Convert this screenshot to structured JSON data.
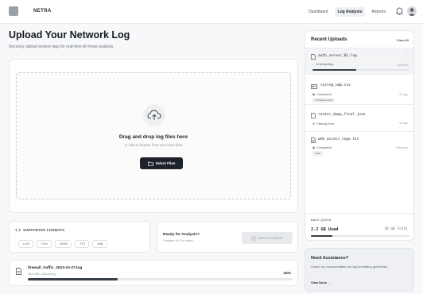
{
  "header": {
    "brand": "NETRA",
    "nav": [
      "Dashboard",
      "Log Analysis",
      "Reports"
    ],
    "active_nav": "Log Analysis"
  },
  "page": {
    "title": "Upload Your Network Log",
    "subtitle": "Securely upload system logs for real-time AI threat analysis."
  },
  "dropzone": {
    "title": "Drag and drop log files here",
    "subtitle": "or click to browse from your local drive",
    "button_label": "Select Files"
  },
  "formats": {
    "title": "SUPPORTED FORMATS",
    "items": [
      ".LOG",
      ".CSV",
      ".JSON",
      ".TXT",
      ".XML"
    ]
  },
  "ready": {
    "title": "Ready for Analysis?",
    "subtitle": "0 engine v3.0 is active.",
    "button_label": "Start AI Analysis"
  },
  "current_upload": {
    "file_name": "firewall_traffic_2023-10-27.log",
    "meta": "45.2 MB • Uploading...",
    "percent_label": "34%",
    "progress": 0.34
  },
  "recent": {
    "title": "Recent Uploads",
    "view_all": "View All",
    "items": [
      {
        "name": "auth_server_01.log",
        "status": "AI Analyzing...",
        "time": "Just Now",
        "tag": "",
        "progress": 0.45
      },
      {
        "name": "syslog_udp.csv",
        "status": "Completed",
        "time": "2h ago",
        "tag": "4 Threats Found",
        "progress": null
      },
      {
        "name": "router_dump_final.json",
        "status": "Parsing Error",
        "time": "5h ago",
        "tag": "",
        "progress": null
      },
      {
        "name": "web_access_logs.txt",
        "status": "Completed",
        "time": "Yesterday",
        "tag": "Clear",
        "progress": null
      }
    ]
  },
  "quota": {
    "label": "DAILY QUOTA",
    "used": "2.2 GB Used",
    "total": "10 GB Total",
    "fraction": 0.22
  },
  "help": {
    "title": "Need Assistance?",
    "body": "Check our documentation for log formatting guidelines.",
    "link": "View Docs →"
  }
}
